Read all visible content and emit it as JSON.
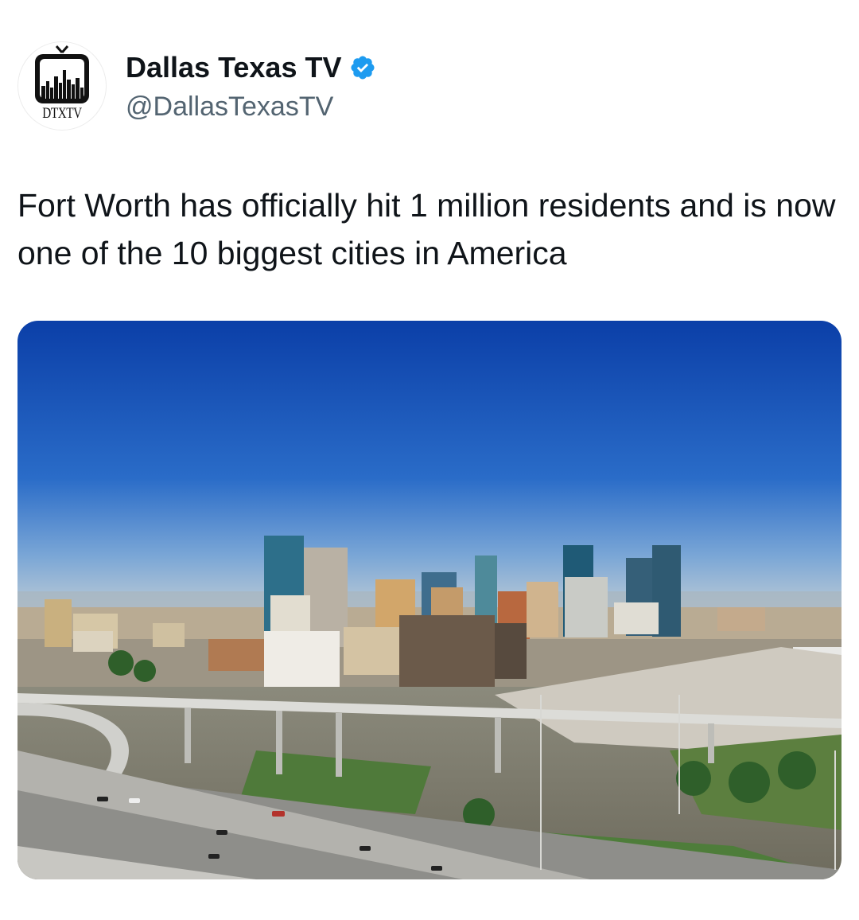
{
  "tweet": {
    "author": {
      "display_name": "Dallas Texas TV",
      "handle": "@DallasTexasTV",
      "avatar_text": "DTXTV",
      "verified": true
    },
    "text": "Fort Worth has officially hit 1 million residents and is now one of the 10 biggest cities in America",
    "media": {
      "type": "photo"
    }
  },
  "icons": {
    "avatar": "tv-skyline-logo-icon",
    "verified": "verified-badge-icon"
  },
  "colors": {
    "verified_blue": "#1d9bf0",
    "handle_gray": "#536471",
    "text": "#0f1419"
  }
}
